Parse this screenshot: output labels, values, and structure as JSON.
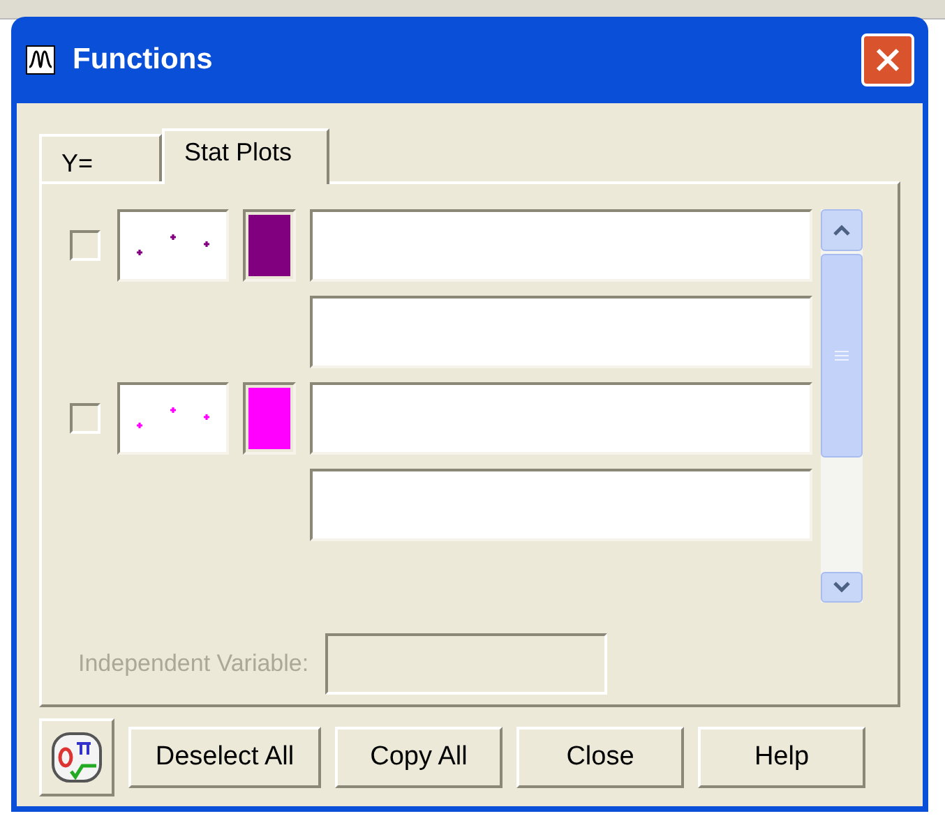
{
  "window": {
    "title": "Functions"
  },
  "tabs": [
    {
      "label": "Y=",
      "selected": false
    },
    {
      "label": "Stat Plots",
      "selected": true
    }
  ],
  "plots": [
    {
      "checked": false,
      "color": "#800080"
    },
    {
      "checked": false,
      "color": "#ff00ff"
    }
  ],
  "independent_variable": {
    "label": "Independent Variable:",
    "disabled": true
  },
  "buttons": [
    "Deselect All",
    "Copy All",
    "Close",
    "Help"
  ]
}
